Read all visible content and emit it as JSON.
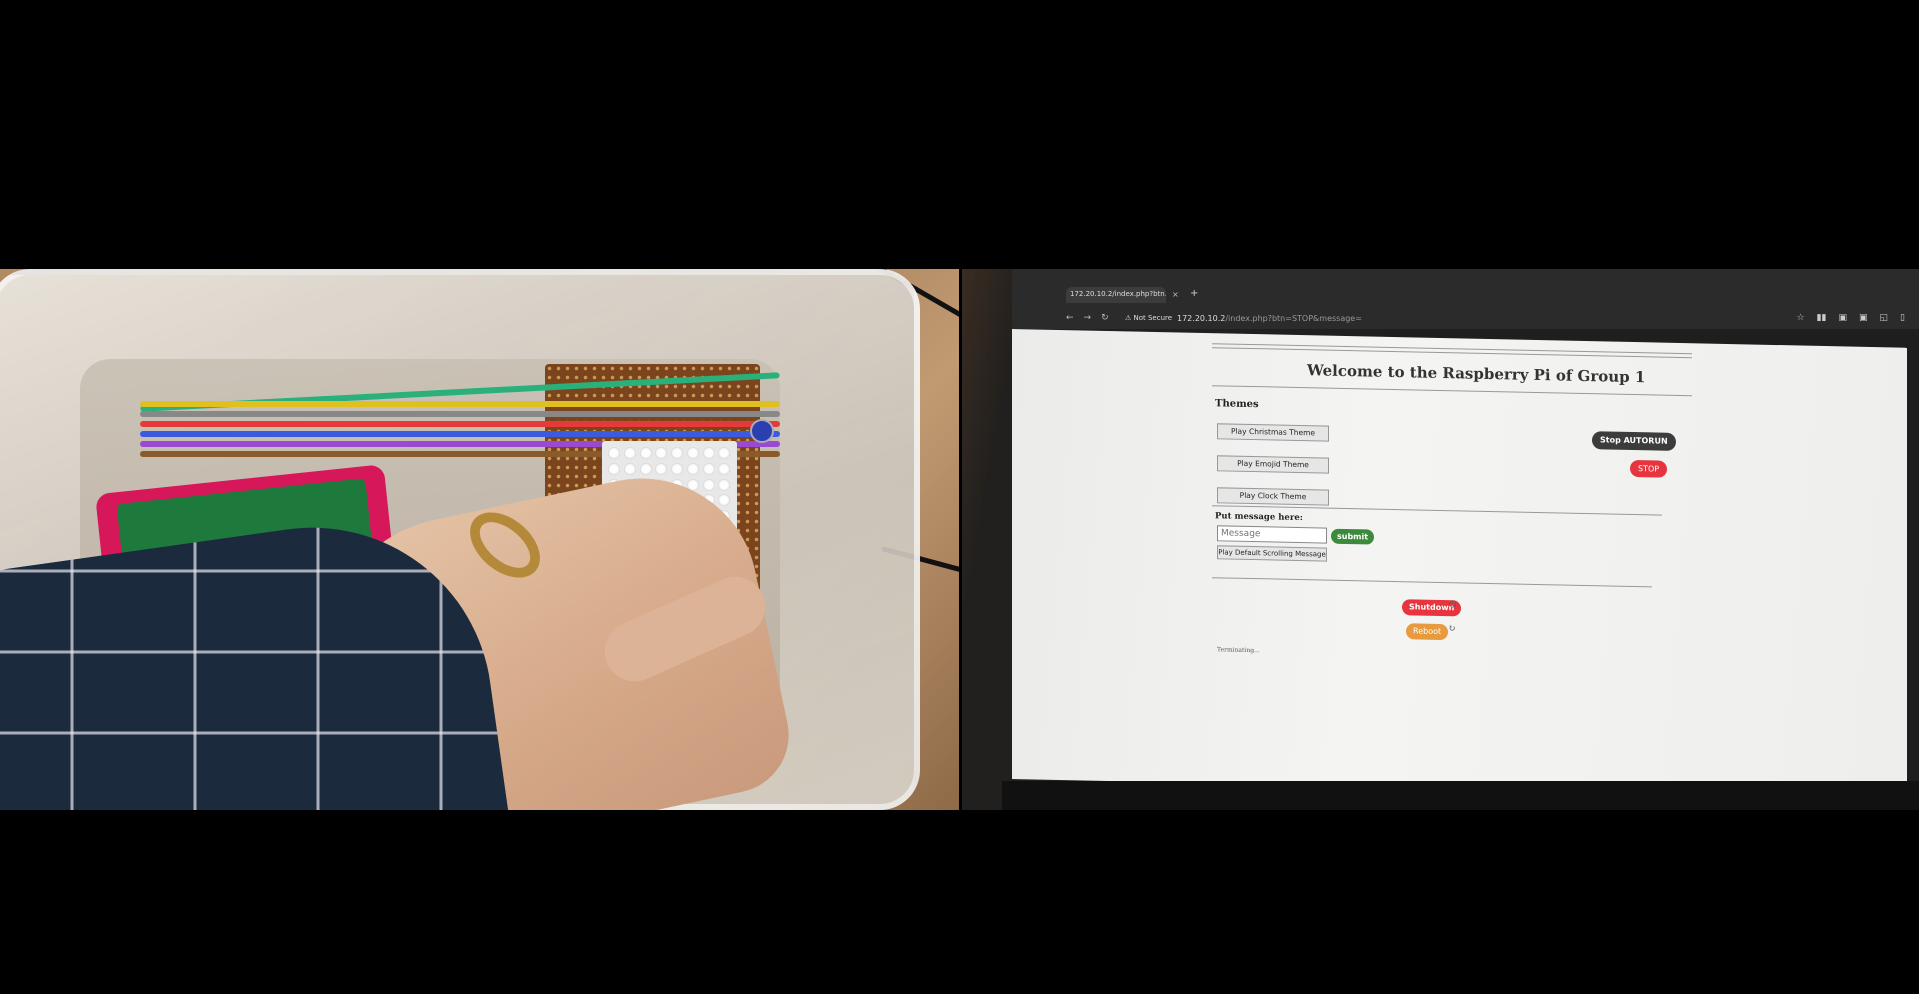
{
  "browser": {
    "tab_title": "172.20.10.2/index.php?btn...",
    "tab_close": "×",
    "new_tab": "+",
    "nav_back": "←",
    "nav_forward": "→",
    "nav_reload": "↻",
    "not_secure": "⚠ Not Secure",
    "url_host": "172.20.10.2",
    "url_path": "/index.php?btn=STOP&message=",
    "toolbar_icons": [
      "☆",
      "▮▮",
      "▣",
      "▣",
      "◱",
      "▯"
    ]
  },
  "page": {
    "title": "Welcome to the Raspberry Pi of Group 1",
    "themes_heading": "Themes",
    "theme_buttons": [
      "Play Christmas Theme",
      "Play Emojid Theme",
      "Play Clock Theme"
    ],
    "stop_autorun": "Stop AUTORUN",
    "stop": "STOP",
    "message_heading": "Put message here:",
    "message_placeholder": "Message",
    "submit": "submit",
    "default_scroll": "Play Default Scrolling Message",
    "shutdown": "Shutdown",
    "reboot": "Reboot",
    "status": "Terminating...",
    "power_icon": "⏻",
    "reload_icon": "↻"
  },
  "colors": {
    "stop_red": "#e8343e",
    "submit_green": "#3c8a3c",
    "reboot_orange": "#e89a3e",
    "autorun_dark": "#3c3c3c"
  }
}
